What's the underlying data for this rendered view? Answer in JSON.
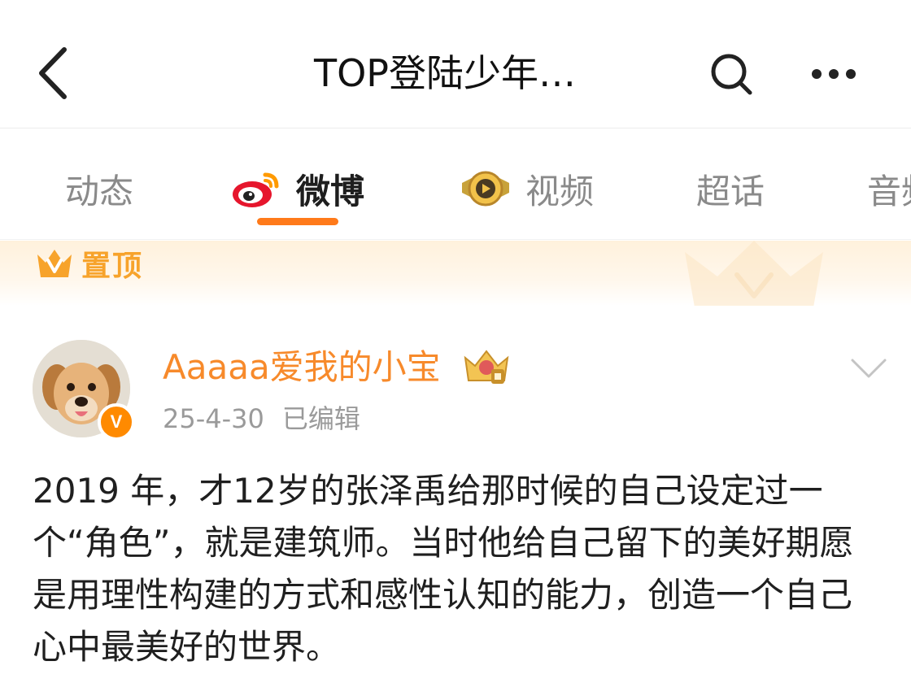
{
  "header": {
    "title": "TOP登陆少年…",
    "back_icon": "chevron-left-icon",
    "search_icon": "search-icon",
    "more_icon": "more-dots-icon"
  },
  "tabs": [
    {
      "label": "动态",
      "active": false
    },
    {
      "label": "微博",
      "active": true,
      "icon": "weibo-logo-icon"
    },
    {
      "label": "视频",
      "active": false,
      "icon": "video-badge-icon"
    },
    {
      "label": "超话",
      "active": false
    },
    {
      "label": "音频",
      "active": false
    }
  ],
  "pinned": {
    "label": "置顶",
    "icon": "crown-v-icon"
  },
  "post": {
    "username": "Aaaaa爱我的小宝",
    "date": "25-4-30",
    "edited": "已编辑",
    "verified_badge": "V",
    "text": "2019 年，才12岁的张泽禹给那时候的自己设定过一个“角色”，就是建筑师。当时他给自己留下的美好期愿是用理性构建的方式和感性认知的能力，创造一个自己心中最美好的世界。"
  },
  "colors": {
    "accent": "#ff7a1a",
    "username": "#f78a2b",
    "pinned": "#f7a32b",
    "meta": "#9a9a9a"
  }
}
